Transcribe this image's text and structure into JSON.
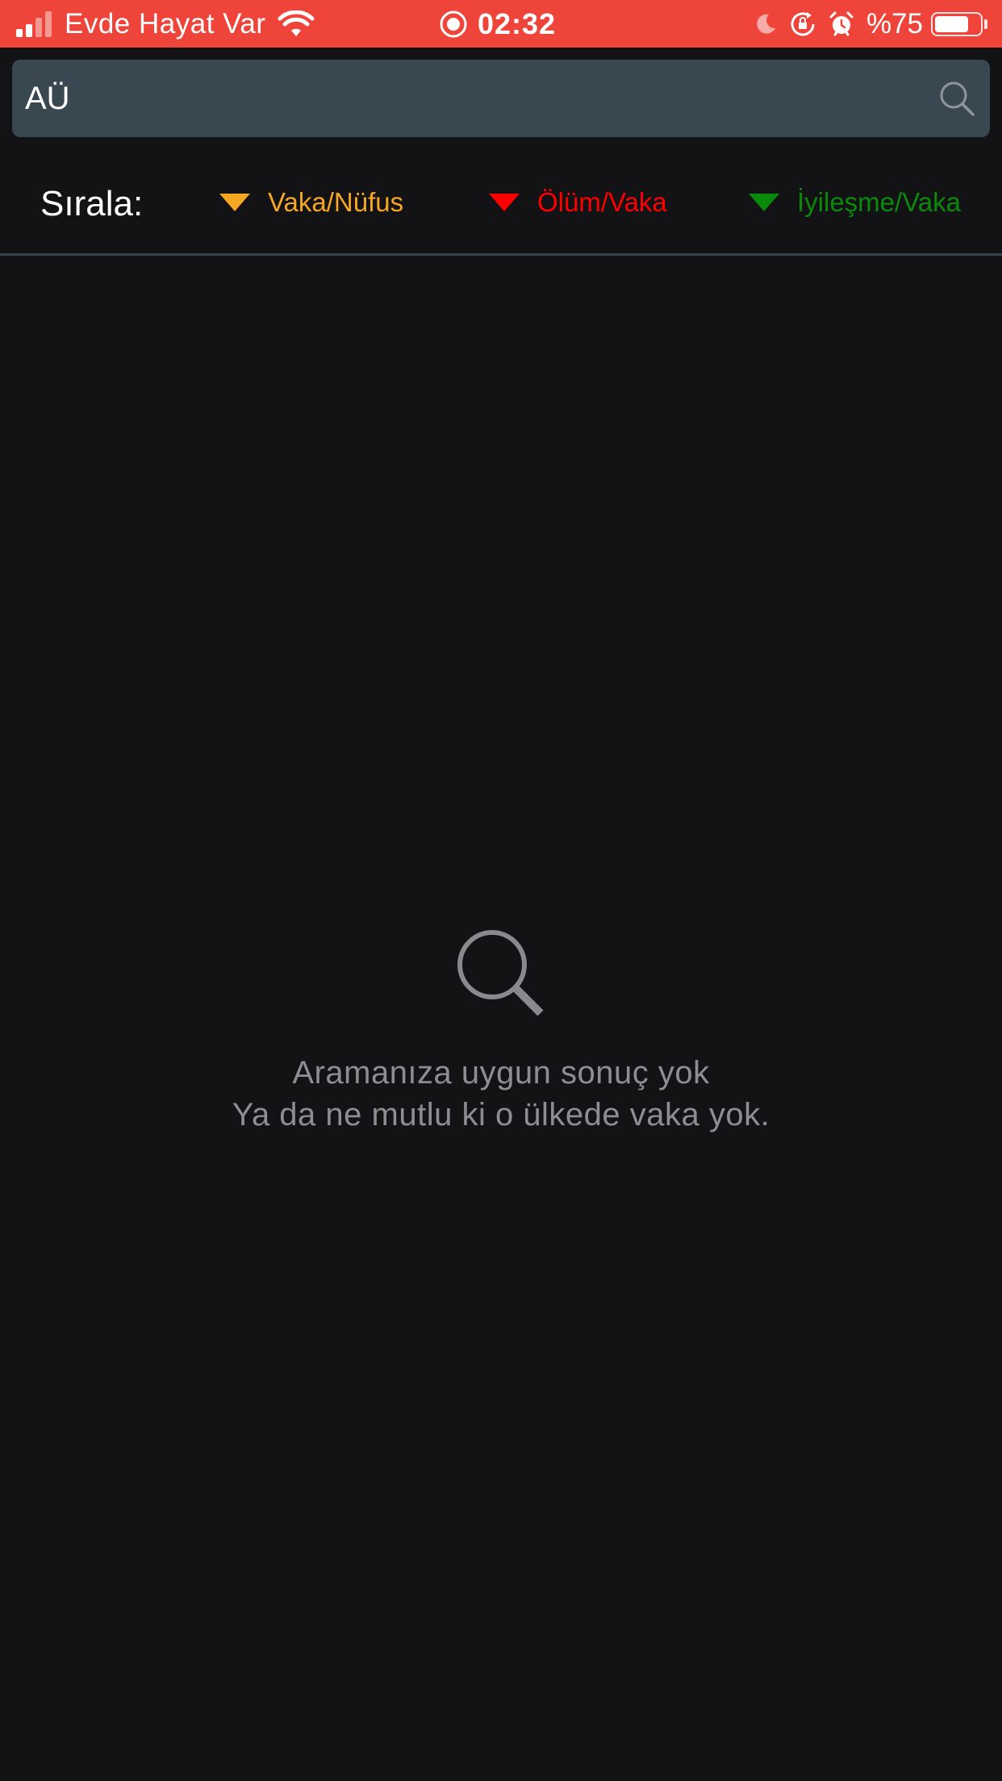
{
  "status_bar": {
    "carrier": "Evde Hayat Var",
    "time": "02:32",
    "battery_percent": "%75",
    "battery_level": 0.75,
    "icons": [
      "signal-icon",
      "wifi-icon",
      "screen-record-icon",
      "moon-icon",
      "rotation-lock-icon",
      "alarm-icon",
      "battery-icon"
    ],
    "background_color": "#ef443a"
  },
  "search": {
    "value": "AÜ",
    "icon": "search-icon"
  },
  "sort": {
    "label": "Sırala:",
    "options": [
      {
        "label": "Vaka/Nüfus",
        "color": "#f5a623",
        "icon": "triangle-down-icon"
      },
      {
        "label": "Ölüm/Vaka",
        "color": "#ff0000",
        "icon": "triangle-down-icon"
      },
      {
        "label": "İyileşme/Vaka",
        "color": "#0a8a0a",
        "icon": "triangle-down-icon"
      }
    ]
  },
  "empty_state": {
    "icon": "search-icon",
    "title": "Aramanıza uygun sonuç yok",
    "subtitle": "Ya da ne mutlu ki o ülkede vaka yok."
  }
}
